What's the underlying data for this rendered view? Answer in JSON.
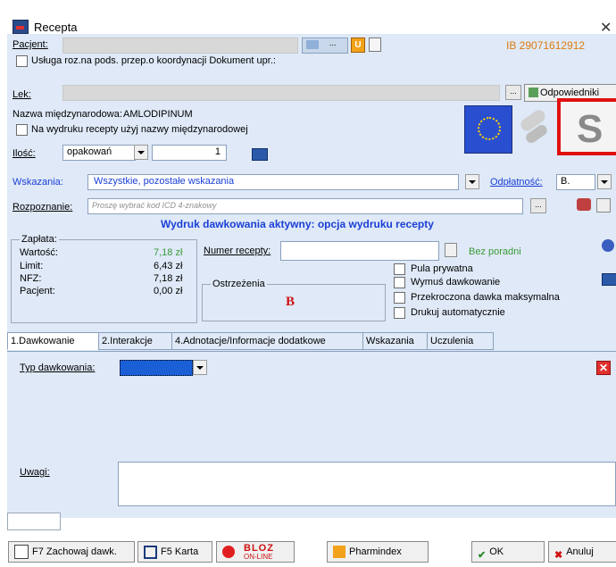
{
  "window": {
    "title": "Recepta",
    "close": "✕"
  },
  "patient": {
    "label": "Pacjent:",
    "ib": "IB 29071612912"
  },
  "service": {
    "label": "Usługa roz.na pods. przep.o koordynacji Dokument upr.:"
  },
  "drug": {
    "label": "Lek:",
    "button": "Odpowiedniki"
  },
  "intl": {
    "name_label": "Nazwa międzynarodowa:",
    "name_value": "AMLODIPINUM",
    "print_label": "Na wydruku recepty użyj nazwy międzynarodowej"
  },
  "qty": {
    "label": "Ilość:",
    "unit": "opakowań",
    "value": "1"
  },
  "indications": {
    "label": "Wskazania:",
    "value": "Wszystkie, pozostałe wskazania"
  },
  "payment": {
    "label": "Odpłatność:",
    "value": "B."
  },
  "diagnosis": {
    "label": "Rozpoznanie:",
    "placeholder": "Proszę wybrać kod ICD 4-znakowy"
  },
  "print_notice": "Wydruk dawkowania aktywny: opcja wydruku recepty",
  "pay": {
    "title": "Zapłata:",
    "rows": [
      {
        "k": "Wartość:",
        "v": "7,18 zł"
      },
      {
        "k": "Limit:",
        "v": "6,43 zł"
      },
      {
        "k": "NFZ:",
        "v": "7,18 zł"
      },
      {
        "k": "Pacjent:",
        "v": "0,00 zł"
      }
    ]
  },
  "rx": {
    "number_label": "Numer recepty:",
    "bez_poradni": "Bez poradni"
  },
  "warnings": {
    "title": "Ostrzeżenia",
    "letter": "B"
  },
  "options": [
    "Pula prywatna",
    "Wymuś dawkowanie",
    "Przekroczona dawka maksymalna",
    "Drukuj automatycznie"
  ],
  "tabs": [
    "1.Dawkowanie",
    "2.Interakcje",
    "4.Adnotacje/Informacje dodatkowe",
    "Wskazania",
    "Uczulenia"
  ],
  "dosing": {
    "type_label": "Typ dawkowania:",
    "notes_label": "Uwagi:"
  },
  "buttons": {
    "save_dose": "F7 Zachowaj dawk.",
    "card": "F5 Karta",
    "bloz_top": "BLOZ",
    "bloz_bottom": "ON-LINE",
    "pharmindex": "Pharmindex",
    "ok": "OK",
    "cancel": "Anuluj"
  },
  "badge": "S",
  "colors": {
    "panel": "#dfe9f7",
    "accent_blue": "#1a3fd6",
    "ib_orange": "#e07a10",
    "green": "#3a9a3a",
    "red_frame": "#e01010"
  }
}
